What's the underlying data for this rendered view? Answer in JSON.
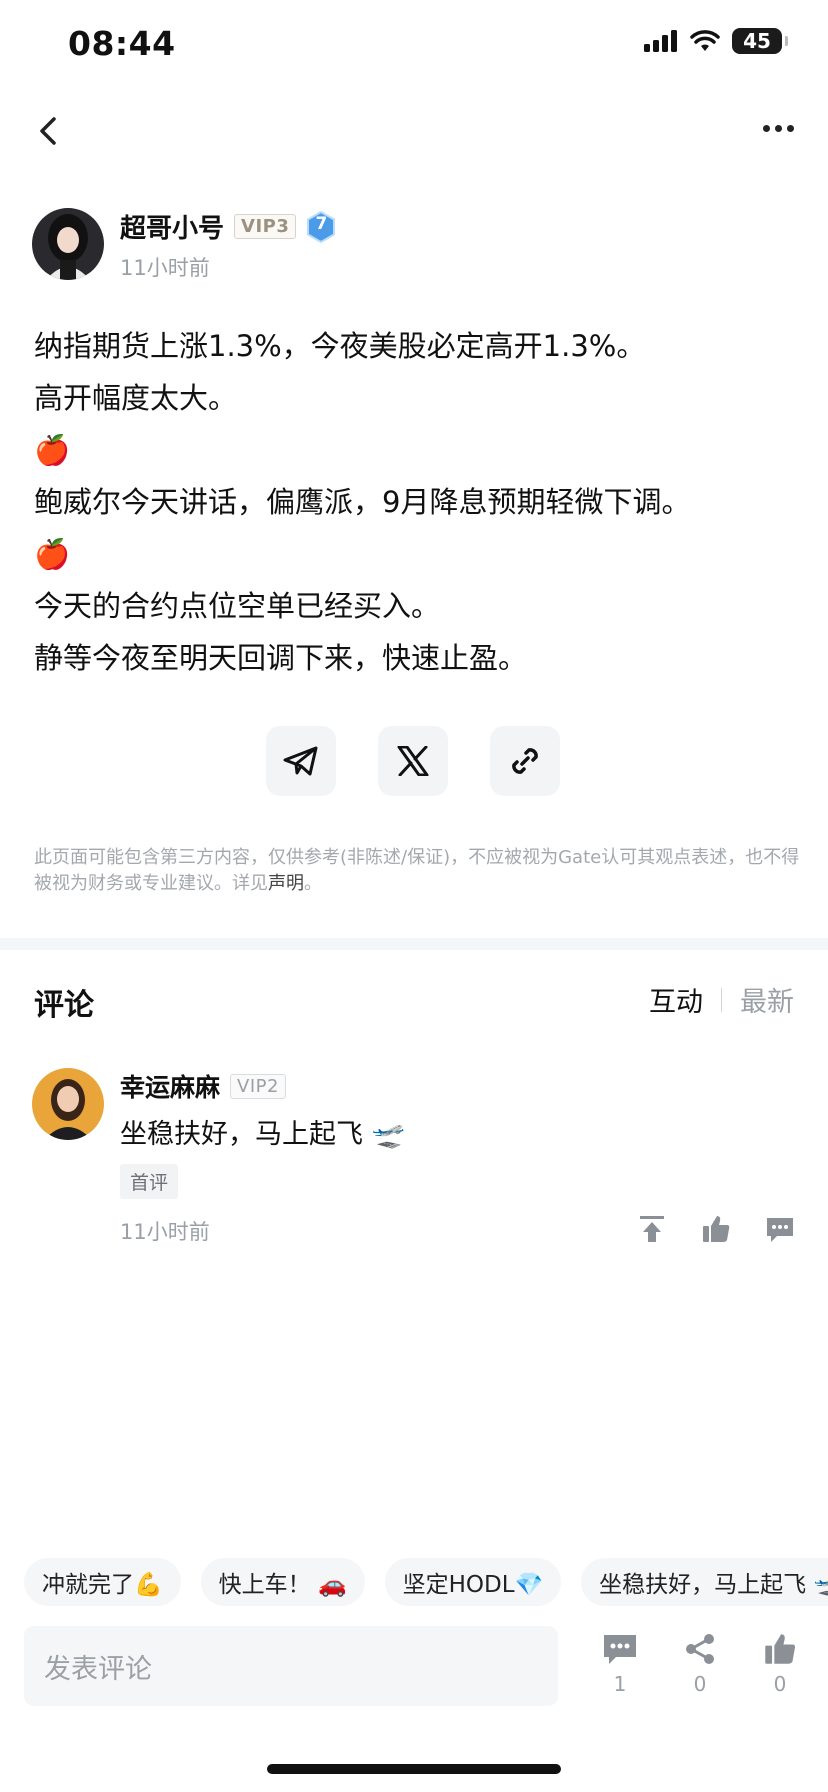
{
  "status_bar": {
    "time": "08:44",
    "battery": "45"
  },
  "post": {
    "author": {
      "name": "超哥小号",
      "vip": "VIP3",
      "level": "7"
    },
    "time": "11小时前",
    "lines": [
      "纳指期货上涨1.3%，今夜美股必定高开1.3%。",
      "高开幅度太大。",
      "🍎",
      "鲍威尔今天讲话，偏鹰派，9月降息预期轻微下调。",
      "🍎",
      "今天的合约点位空单已经买入。",
      "静等今夜至明天回调下来，快速止盈。"
    ]
  },
  "share": {
    "icons": [
      "telegram-icon",
      "x-icon",
      "link-icon"
    ]
  },
  "disclaimer": {
    "text": "此页面可能包含第三方内容，仅供参考(非陈述/保证)，不应被视为Gate认可其观点表述，也不得被视为财务或专业建议。详见",
    "link": "声明",
    "end": "。"
  },
  "comments_section": {
    "title": "评论",
    "sort_active": "互动",
    "sort_inactive": "最新"
  },
  "comment": {
    "name": "幸运麻麻",
    "vip": "VIP2",
    "text": "坐稳扶好，马上起飞 🛫",
    "tag": "首评",
    "time": "11小时前"
  },
  "quick_replies": [
    "冲就完了💪",
    "快上车！ 🚗",
    "坚定HODL💎",
    "坐稳扶好，马上起飞 🛫"
  ],
  "input": {
    "placeholder": "发表评论"
  },
  "bottom_actions": {
    "comments": "1",
    "shares": "0",
    "likes": "0"
  },
  "colors": {
    "avatar1": "#2a2a2e",
    "avatar2": "#e9a43a",
    "badge_blue": "#4a9be8"
  }
}
